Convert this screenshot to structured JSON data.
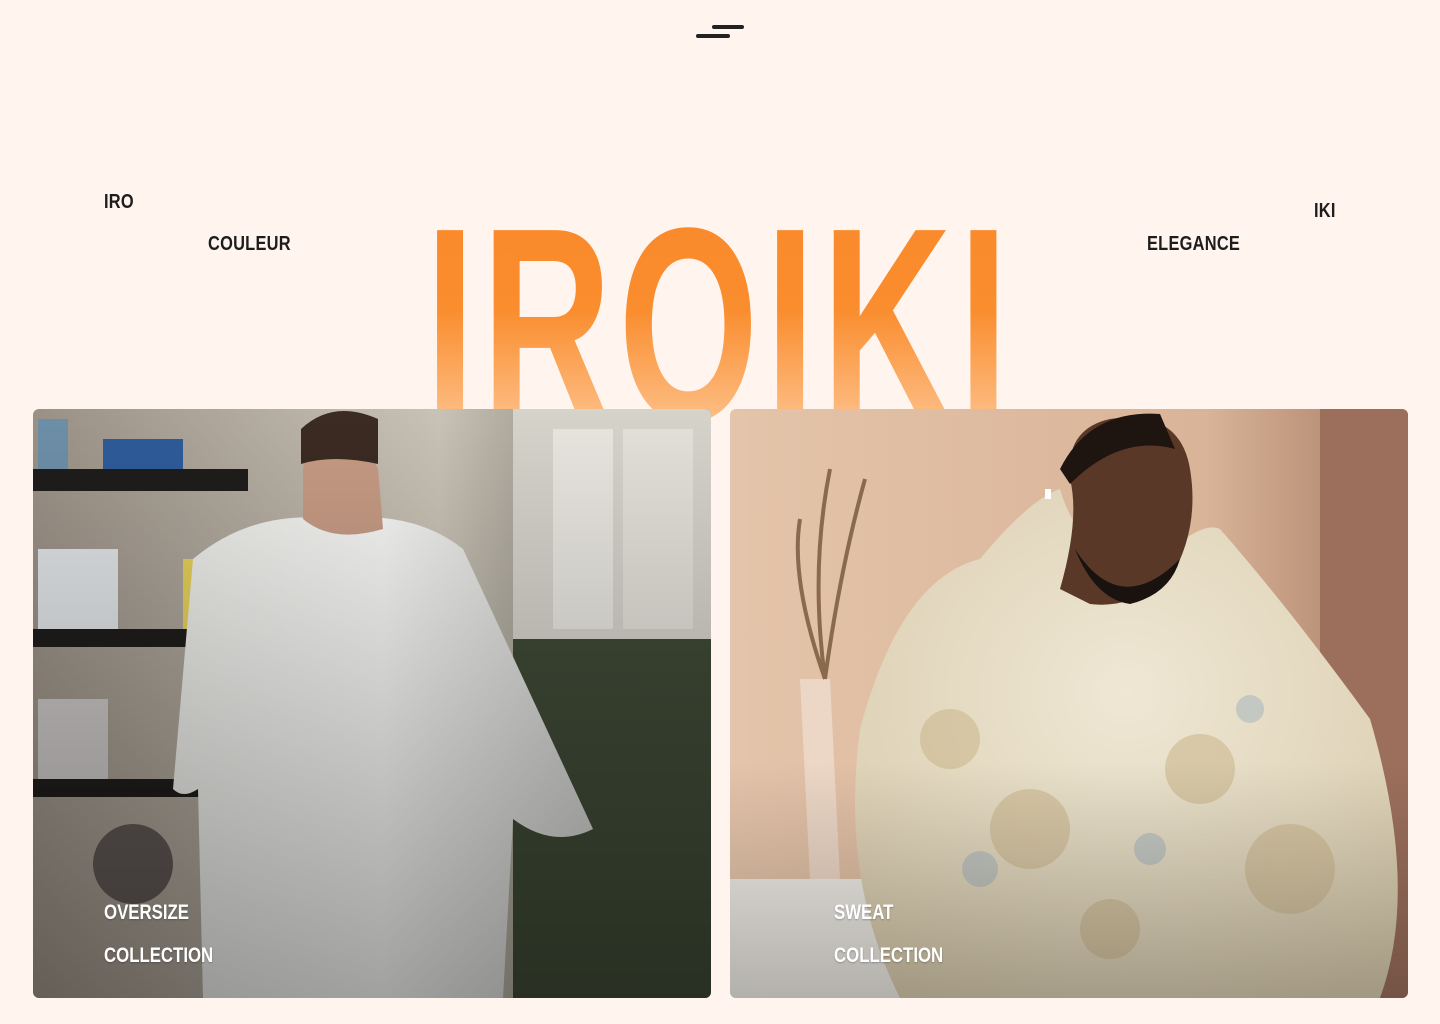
{
  "menu": {
    "icon": "hamburger-menu-icon"
  },
  "hero": {
    "brand": "IROIKI",
    "words": {
      "iro": "IRO",
      "couleur": "COULEUR",
      "elegance": "ELEGANCE",
      "iki": "IKI"
    }
  },
  "collections": [
    {
      "line1": "OVERSIZE",
      "line2": "COLLECTION"
    },
    {
      "line1": "SWEAT",
      "line2": "COLLECTION"
    }
  ],
  "colors": {
    "background": "#fff4ee",
    "brand_orange": "#f9892a",
    "brand_orange_light": "#ffd2a8",
    "text_dark": "#1d1d1d"
  }
}
